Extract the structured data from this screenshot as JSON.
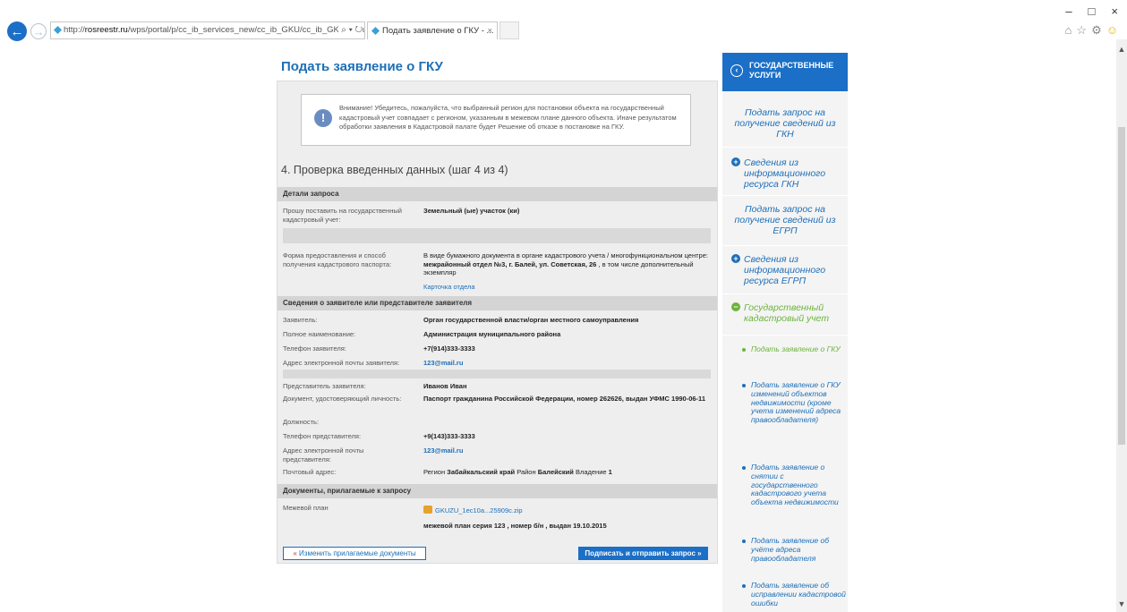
{
  "browser": {
    "url_prefix": "http://",
    "url_domain": "rosreestr.ru",
    "url_path": "/wps/portal/p/cc_ib_services_new/cc_ib_GKU/cc_ib_GKU_request/!ut/j",
    "url_tools": "⌕ ▾ ↻",
    "tab_title": "Подать заявление о ГКУ - ...",
    "tab_close": "×",
    "back_icon": "←",
    "forward_icon": "→",
    "window_controls": [
      "–",
      "□",
      "×"
    ],
    "toolbar_icons": [
      "⌂",
      "☆",
      "⚙",
      "☺"
    ]
  },
  "page": {
    "title": "Подать заявление о ГКУ",
    "warning": "Внимание! Убедитесь, пожалуйста, что выбранный регион для постановки объекта на государственный кадастровый учет совпадает с регионом, указанным в межевом плане данного объекта. Иначе результатом обработки заявления в Кадастровой палате будет Решение об отказе в постановке на ГКУ.",
    "warning_icon": "!",
    "step_title": "4. Проверка введенных данных (шаг 4 из 4)",
    "section_request": "Детали запроса",
    "req_label": "Прошу поставить на государственный кадастровый учет:",
    "req_value": "Земельный (ые) участок (ки)",
    "form_label": "Форма предоставления и способ получения кадастрового паспорта:",
    "form_value_1": "В виде бумажного документа в органе кадастрового учета / многофункциональном центре: ",
    "form_value_bold": "межрайонный отдел №3, г. Балей, ул. Советская, 26",
    "form_value_2": " , в том числе дополнительный экземпляр",
    "card_link": "Карточка отдела",
    "section_applicant": "Сведения о заявителе или представителе заявителя",
    "applicant_rows": [
      {
        "label": "Заявитель:",
        "value": "Орган государственной власти/орган местного самоуправления"
      },
      {
        "label": "Полное наименование:",
        "value": "Администрация муниципального района"
      },
      {
        "label": "Телефон заявителя:",
        "value": "+7(914)333-3333"
      },
      {
        "label": "Адрес электронной почты заявителя:",
        "value": "123@mail.ru"
      }
    ],
    "rep_rows": [
      {
        "label": "Представитель заявителя:",
        "value": "Иванов Иван"
      },
      {
        "label": "Документ, удостоверяющий личность:",
        "value": "Паспорт гражданина Российской Федерации, номер 262626, выдан УФМС 1990-06-11"
      },
      {
        "label": "Должность:",
        "value": ""
      },
      {
        "label": "Телефон представителя:",
        "value": "+9(143)333-3333"
      },
      {
        "label": "Адрес электронной почты представителя:",
        "value": "123@mail.ru"
      }
    ],
    "postal_label": "Почтовый адрес:",
    "postal_1": "Регион ",
    "postal_region": "Забайкальский край",
    "postal_2": " Район ",
    "postal_district": "Балейский",
    "postal_3": " Владение ",
    "postal_num": "1",
    "section_docs": "Документы, прилагаемые к запросу",
    "docs_label": "Межевой план",
    "docs_file": "GKUZU_1ec10a...25909c.zip",
    "docs_desc": "межевой план серия 123 , номер б/н , выдан 19.10.2015",
    "btn_change_mark": "«",
    "btn_change": " Изменить прилагаемые документы",
    "btn_send": "Подписать и отправить запрос »"
  },
  "sidebar": {
    "header": "ГОСУДАРСТВЕННЫЕ УСЛУГИ",
    "back_icon": "‹",
    "items": [
      "Подать запрос на получение сведений из ГКН",
      "Сведения из информационного ресурса ГКН",
      "Подать запрос на получение сведений из ЕГРП",
      "Сведения из информационного ресурса ЕГРП",
      "Государственный кадастровый учет"
    ],
    "plus": "+",
    "minus": "−",
    "subitems": [
      "Подать заявление о ГКУ",
      "Подать заявление о ГКУ изменений объектов недвижимости (кроме учета изменений адреса правообладателя)",
      "Подать заявление о снятии с государственного кадастрового учета объекта недвижимости",
      "Подать заявление об учёте адреса правообладателя",
      "Подать заявление об исправлении кадастровой ошибки"
    ]
  },
  "scrollbar": {
    "up": "▲",
    "down": "▼"
  }
}
